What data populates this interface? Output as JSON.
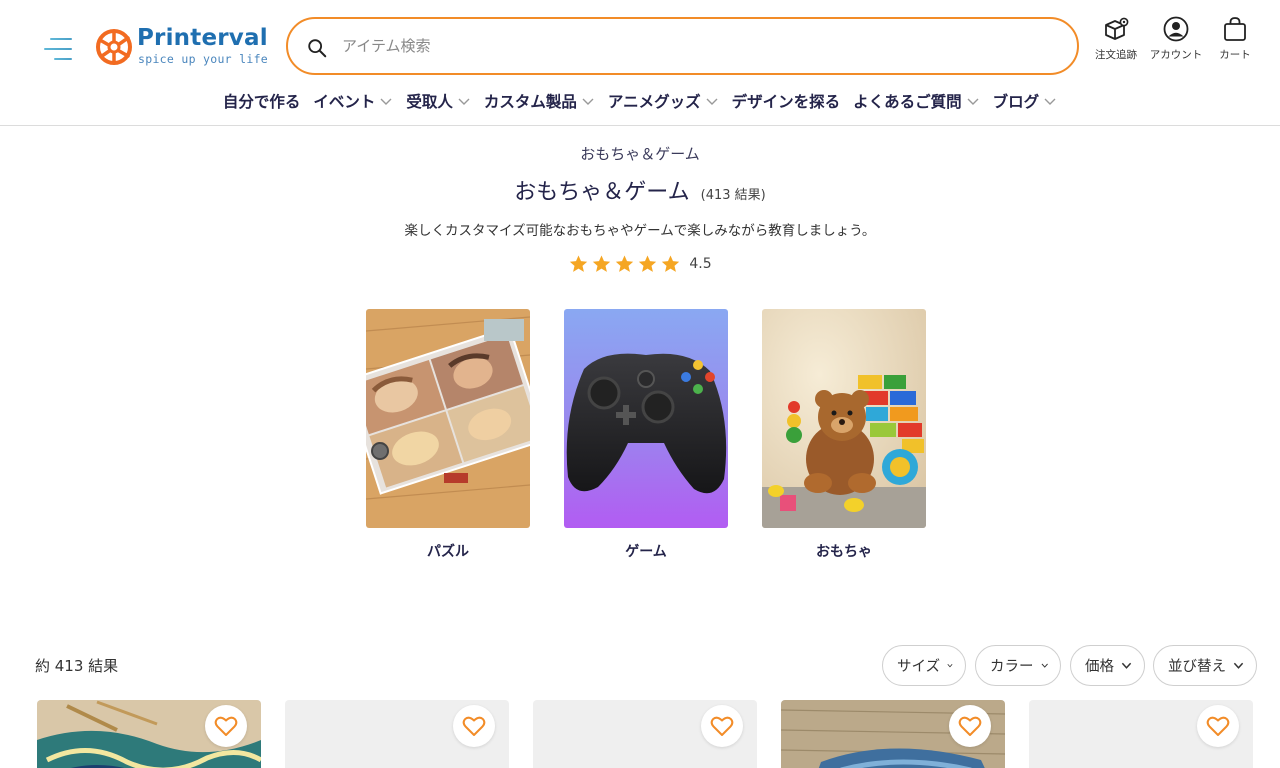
{
  "header": {
    "logo": {
      "name": "Printerval",
      "tagline": "spice up your life"
    },
    "search": {
      "placeholder": "アイテム検索"
    },
    "actions": {
      "track": "注文追跡",
      "account": "アカウント",
      "cart": "カート"
    }
  },
  "nav": {
    "items": [
      {
        "label": "自分で作る",
        "dropdown": false
      },
      {
        "label": "イベント",
        "dropdown": true
      },
      {
        "label": "受取人",
        "dropdown": true
      },
      {
        "label": "カスタム製品",
        "dropdown": true
      },
      {
        "label": "アニメグッズ",
        "dropdown": true
      },
      {
        "label": "デザインを探る",
        "dropdown": false
      },
      {
        "label": "よくあるご質問",
        "dropdown": true
      },
      {
        "label": "ブログ",
        "dropdown": true
      }
    ]
  },
  "category": {
    "breadcrumb": "おもちゃ＆ゲーム",
    "title": "おもちゃ＆ゲーム",
    "count": "(413 結果)",
    "description": "楽しくカスタマイズ可能なおもちゃやゲームで楽しみながら教育しましょう。",
    "rating": {
      "stars": 5,
      "value": 4.5,
      "label": "4.5"
    },
    "subcategories": [
      {
        "name": "パズル",
        "image": "puzzle-photo"
      },
      {
        "name": "ゲーム",
        "image": "game-controller-photo"
      },
      {
        "name": "おもちゃ",
        "image": "teddy-bear-toys-photo"
      }
    ]
  },
  "results": {
    "count_label": "約 413 結果",
    "filters": {
      "size": "サイズ",
      "color": "カラー",
      "price": "価格",
      "sort": "並び替え"
    }
  },
  "products": [
    {
      "image": "van-gogh-puzzle",
      "favorite": false
    },
    {
      "image": "loading-placeholder",
      "favorite": false
    },
    {
      "image": "loading-placeholder",
      "favorite": false
    },
    {
      "image": "wood-puzzle",
      "favorite": false
    },
    {
      "image": "loading-placeholder",
      "favorite": false
    }
  ],
  "colors": {
    "accent": "#f28c28",
    "brand": "#1f6fb0",
    "star": "#f5a623",
    "text": "#24244a"
  }
}
